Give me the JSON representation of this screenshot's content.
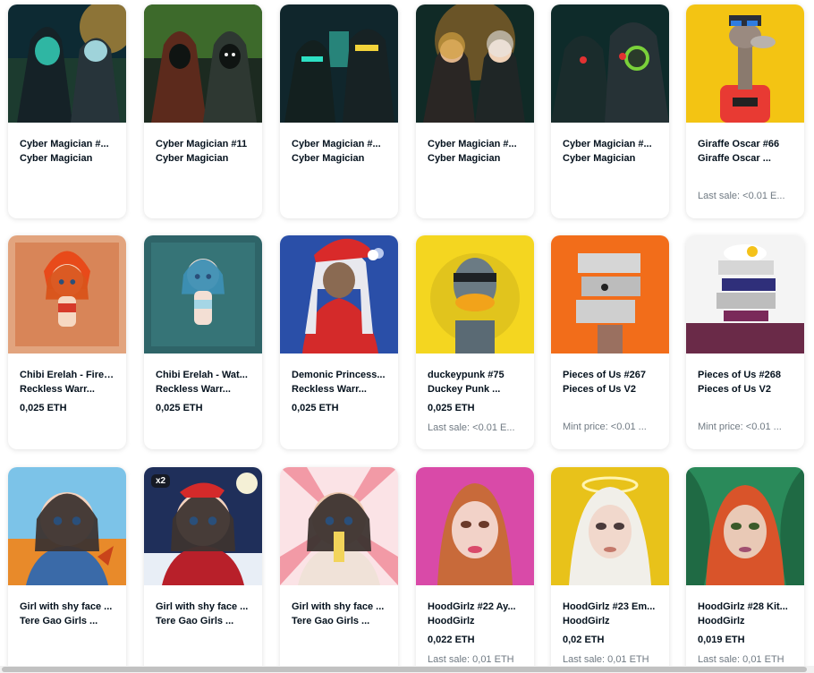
{
  "cards": [
    {
      "name": "Cyber Magician #...",
      "collection": "Cyber Magician",
      "price": "",
      "last_sale": "",
      "badge": "",
      "art": "cyber1"
    },
    {
      "name": "Cyber Magician #11",
      "collection": "Cyber Magician",
      "price": "",
      "last_sale": "",
      "badge": "",
      "art": "cyber2"
    },
    {
      "name": "Cyber Magician #...",
      "collection": "Cyber Magician",
      "price": "",
      "last_sale": "",
      "badge": "",
      "art": "cyber3"
    },
    {
      "name": "Cyber Magician #...",
      "collection": "Cyber Magician",
      "price": "",
      "last_sale": "",
      "badge": "",
      "art": "cyber4"
    },
    {
      "name": "Cyber Magician #...",
      "collection": "Cyber Magician",
      "price": "",
      "last_sale": "",
      "badge": "",
      "art": "cyber5"
    },
    {
      "name": "Giraffe Oscar #66",
      "collection": "Giraffe Oscar ...",
      "price": "",
      "last_sale": "Last sale: <0.01 E...",
      "badge": "",
      "art": "giraffe"
    },
    {
      "name": "Chibi Erelah - Fire ...",
      "collection": "Reckless Warr...",
      "price": "0,025 ETH",
      "last_sale": "",
      "badge": "",
      "art": "chibifire"
    },
    {
      "name": "Chibi Erelah - Wat...",
      "collection": "Reckless Warr...",
      "price": "0,025 ETH",
      "last_sale": "",
      "badge": "",
      "art": "chibiwater"
    },
    {
      "name": "Demonic Princess...",
      "collection": "Reckless Warr...",
      "price": "0,025 ETH",
      "last_sale": "",
      "badge": "",
      "art": "demonic"
    },
    {
      "name": "duckeypunk #75",
      "collection": "Duckey Punk ...",
      "price": "0,025 ETH",
      "last_sale": "Last sale: <0.01 E...",
      "badge": "",
      "art": "duck"
    },
    {
      "name": "Pieces of Us #267",
      "collection": "Pieces of Us V2",
      "price": "",
      "last_sale": "Mint price: <0.01 ...",
      "badge": "",
      "art": "pieces1"
    },
    {
      "name": "Pieces of Us #268",
      "collection": "Pieces of Us V2",
      "price": "",
      "last_sale": "Mint price: <0.01 ...",
      "badge": "",
      "art": "pieces2"
    },
    {
      "name": "Girl with shy face ...",
      "collection": "Tere Gao Girls ...",
      "price": "",
      "last_sale": "",
      "badge": "",
      "art": "girl1"
    },
    {
      "name": "Girl with shy face ...",
      "collection": "Tere Gao Girls ...",
      "price": "",
      "last_sale": "",
      "badge": "x2",
      "art": "girl2"
    },
    {
      "name": "Girl with shy face ...",
      "collection": "Tere Gao Girls ...",
      "price": "",
      "last_sale": "",
      "badge": "",
      "art": "girl3"
    },
    {
      "name": "HoodGirlz #22 Ay...",
      "collection": "HoodGirlz",
      "price": "0,022 ETH",
      "last_sale": "Last sale: 0,01 ETH",
      "badge": "",
      "art": "hood1"
    },
    {
      "name": "HoodGirlz #23 Em...",
      "collection": "HoodGirlz",
      "price": "0,02 ETH",
      "last_sale": "Last sale: 0,01 ETH",
      "badge": "",
      "art": "hood2"
    },
    {
      "name": "HoodGirlz #28 Kit...",
      "collection": "HoodGirlz",
      "price": "0,019 ETH",
      "last_sale": "Last sale: 0,01 ETH",
      "badge": "",
      "art": "hood3"
    }
  ]
}
